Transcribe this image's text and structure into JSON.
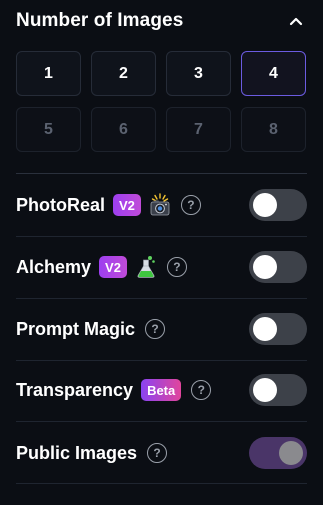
{
  "section": {
    "title": "Number of Images",
    "collapse_icon": "chevron-up-icon"
  },
  "image_counts": [
    {
      "label": "1",
      "state": "default"
    },
    {
      "label": "2",
      "state": "default"
    },
    {
      "label": "3",
      "state": "default"
    },
    {
      "label": "4",
      "state": "selected"
    },
    {
      "label": "5",
      "state": "disabled"
    },
    {
      "label": "6",
      "state": "disabled"
    },
    {
      "label": "7",
      "state": "disabled"
    },
    {
      "label": "8",
      "state": "disabled"
    }
  ],
  "settings": [
    {
      "label": "PhotoReal",
      "badge": "V2",
      "icon": "camera-sparkle-icon",
      "help": "?",
      "enabled": false
    },
    {
      "label": "Alchemy",
      "badge": "V2",
      "icon": "potion-flask-icon",
      "help": "?",
      "enabled": false
    },
    {
      "label": "Prompt Magic",
      "help": "?",
      "enabled": false
    },
    {
      "label": "Transparency",
      "badge": "Beta",
      "help": "?",
      "enabled": false
    },
    {
      "label": "Public Images",
      "help": "?",
      "enabled": true
    }
  ],
  "colors": {
    "background": "#0b0e14",
    "selected_border": "#6b5be0",
    "badge_gradient_start": "#9d3ff0",
    "toggle_on_track": "#4a3568",
    "toggle_off_track": "#3d4149"
  }
}
